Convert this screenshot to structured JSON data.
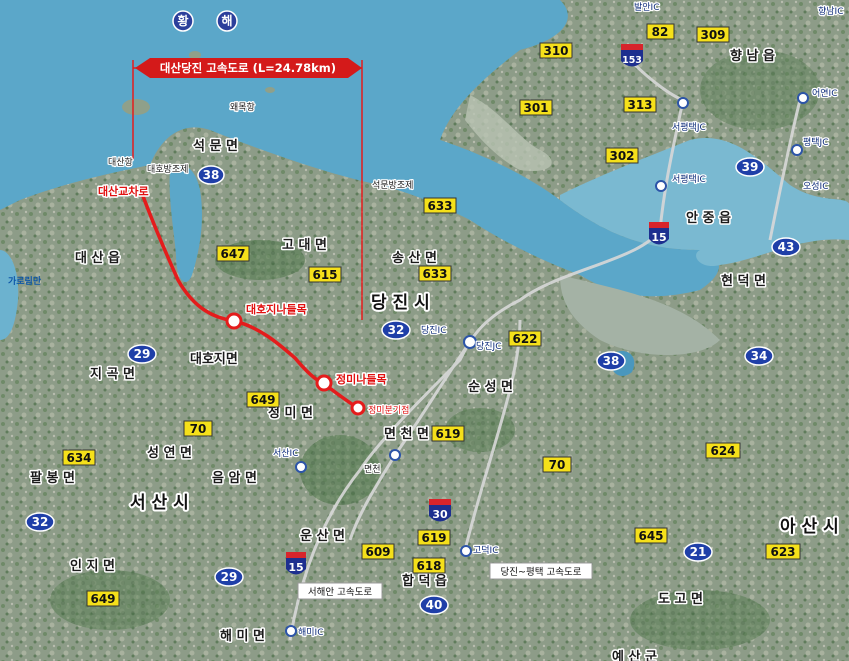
{
  "sea_label_chars": [
    "황",
    "해"
  ],
  "project": {
    "banner": "대산당진 고속도로 (L=24.78km)",
    "start_label": "대산교차로",
    "stations": [
      "대호지나들목",
      "정미나들목",
      "정미분기점"
    ]
  },
  "colors": {
    "sea": "#5ba7c9",
    "land": "#8a9a86",
    "route": "#e41c1c",
    "national_route_shield": "#1f3fa8",
    "provincial_route_sign": "#f5e01a",
    "expressway_shield": "#1d2f8f"
  },
  "places": {
    "seokmun": "석 문 면",
    "godae": "고 대 면",
    "songsan": "송 산 면",
    "dangjin": "당 진 시",
    "daesan": "대 산 읍",
    "daehoji": "대호지면",
    "jigok": "지 곡 면",
    "jeongmi": "정 미 면",
    "sunseong": "순 성 면",
    "myeoncheon": "면 천 면",
    "seongyeon": "성 연 면",
    "eumam": "음 암 면",
    "palbong": "팔 봉 면",
    "seosan": "서 산 시",
    "unsan": "운 산 면",
    "haemi": "해 미 면",
    "inji": "인 지 면",
    "hapdeok": "합 덕 읍",
    "godeok": "고 덕 면",
    "dogo": "도 고 면",
    "asan": "아 산 시",
    "yesan": "예 산 군",
    "hyeondeok": "현 덕 면",
    "anjung": "안 중 읍",
    "hyangnam": "향 남 읍"
  },
  "small_labels": {
    "daesanhang": "대산항",
    "daehobangjo": "대호방조제",
    "daeho_lake": "대 호 지 면",
    "seokmun_dike": "석문방조제",
    "waemok": "왜목항",
    "nanji": "난지도",
    "myeoncheon_small": "면천",
    "garorim": "가로림만"
  },
  "ics": {
    "balan": "발안IC",
    "hyangnam": "향남IC",
    "eoyeon": "어연IC",
    "pyeongtaek_jc": "평택JC",
    "osan": "오성IC",
    "seopyeongtaek_jc": "서평택JC",
    "seopyeongtaek_ic": "서평택IC",
    "dangjin": "당진IC",
    "dangjin_jc": "당진JC",
    "seosan": "서산IC",
    "haemi": "해미IC",
    "godeok": "고덕IC"
  },
  "expressways": [
    "153",
    "15",
    "30",
    "15"
  ],
  "national_routes": [
    "38",
    "39",
    "43",
    "32",
    "29",
    "38",
    "34",
    "32",
    "29",
    "21",
    "40"
  ],
  "provincial_routes": [
    "310",
    "82",
    "309",
    "301",
    "313",
    "302",
    "633",
    "647",
    "615",
    "633",
    "622",
    "649",
    "70",
    "619",
    "634",
    "70",
    "624",
    "609",
    "619",
    "618",
    "645",
    "623",
    "649"
  ],
  "notes": {
    "dangjin_pyeongtaek": "당진~평택 고속도로",
    "seohaean": "서해안 고속도로"
  }
}
